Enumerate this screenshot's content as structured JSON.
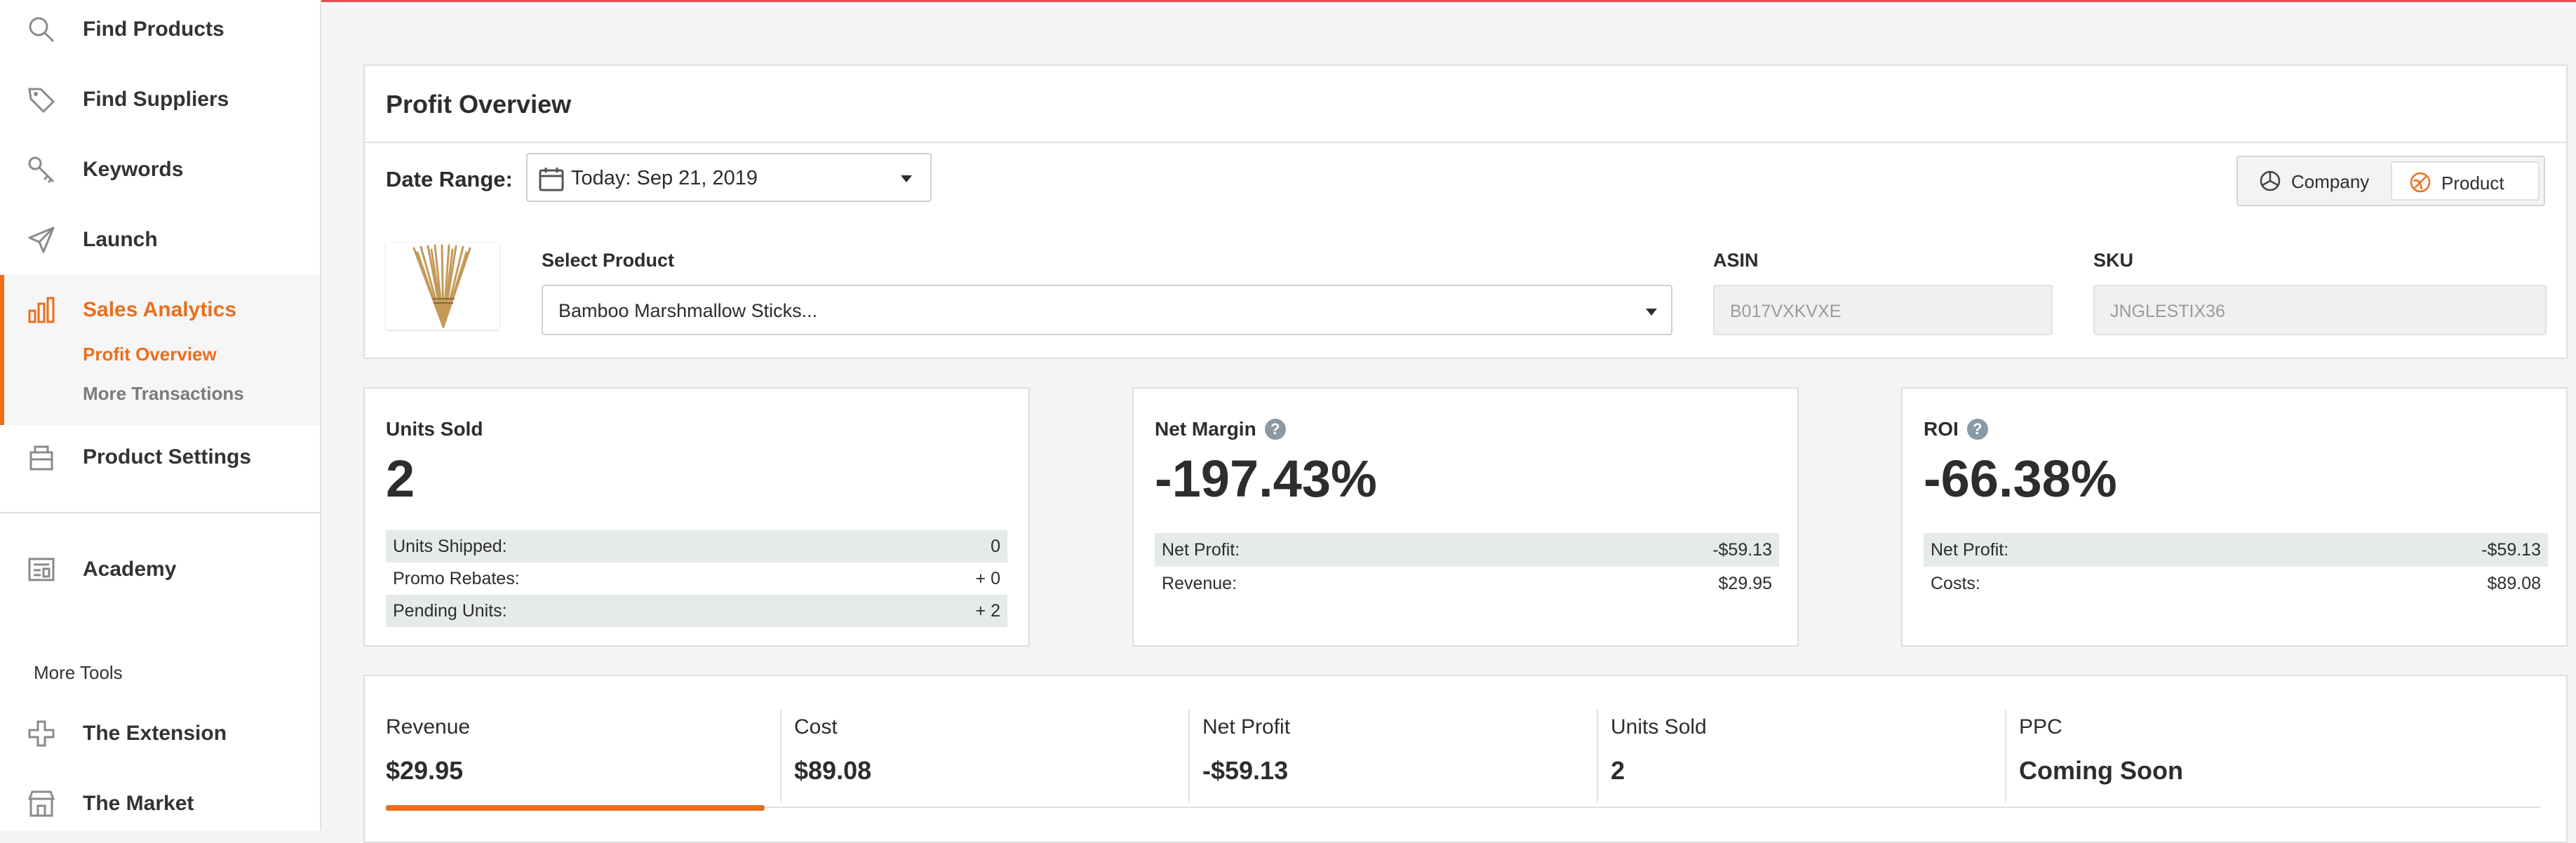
{
  "sidebar": {
    "items": [
      {
        "label": "Find Products",
        "icon": "search-icon"
      },
      {
        "label": "Find Suppliers",
        "icon": "tag-icon"
      },
      {
        "label": "Keywords",
        "icon": "key-icon"
      },
      {
        "label": "Launch",
        "icon": "paper-plane-icon"
      },
      {
        "label": "Sales Analytics",
        "icon": "bar-chart-icon"
      },
      {
        "label": "Product Settings",
        "icon": "box-icon"
      },
      {
        "label": "Academy",
        "icon": "book-icon"
      },
      {
        "label": "The Extension",
        "icon": "puzzle-icon"
      },
      {
        "label": "The Market",
        "icon": "store-icon"
      }
    ],
    "sub_items": [
      {
        "label": "Profit Overview"
      },
      {
        "label": "More Transactions"
      }
    ],
    "more_tools": "More Tools",
    "accent": "#ec6d1c"
  },
  "overview": {
    "title": "Profit Overview",
    "date_range_label": "Date Range:",
    "date_range_value": "Today: Sep 21, 2019",
    "toggle": {
      "company": "Company",
      "product": "Product",
      "selected": "Product"
    },
    "select_product_label": "Select Product",
    "product_value": "Bamboo Marshmallow Sticks...",
    "asin_label": "ASIN",
    "asin_value": "B017VXKVXE",
    "sku_label": "SKU",
    "sku_value": "JNGLESTIX36"
  },
  "metrics": {
    "units": {
      "title": "Units Sold",
      "value": "2",
      "rows": [
        {
          "label": "Units Shipped:",
          "value": "0"
        },
        {
          "label": "Promo Rebates:",
          "value": "+ 0"
        },
        {
          "label": "Pending Units:",
          "value": "+ 2"
        }
      ]
    },
    "margin": {
      "title": "Net Margin",
      "help": "?",
      "value": "-197.43%",
      "rows": [
        {
          "label": "Net Profit:",
          "value": "-$59.13"
        },
        {
          "label": "Revenue:",
          "value": "$29.95"
        }
      ]
    },
    "roi": {
      "title": "ROI",
      "help": "?",
      "value": "-66.38%",
      "rows": [
        {
          "label": "Net Profit:",
          "value": "-$59.13"
        },
        {
          "label": "Costs:",
          "value": "$89.08"
        }
      ]
    }
  },
  "stats": [
    {
      "label": "Revenue",
      "value": "$29.95"
    },
    {
      "label": "Cost",
      "value": "$89.08"
    },
    {
      "label": "Net Profit",
      "value": "-$59.13"
    },
    {
      "label": "Units Sold",
      "value": "2"
    },
    {
      "label": "PPC",
      "value": "Coming Soon"
    }
  ],
  "stats_active": "Revenue"
}
